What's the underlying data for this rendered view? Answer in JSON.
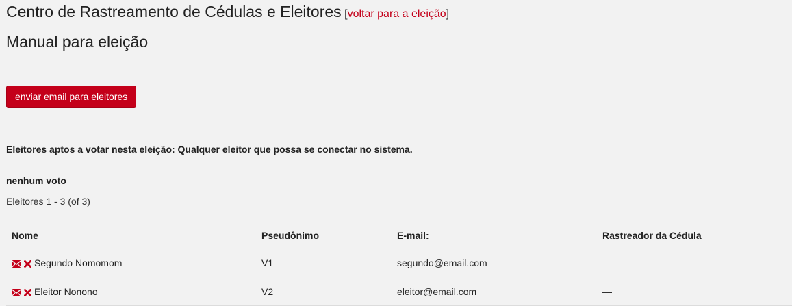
{
  "header": {
    "title": "Centro de Rastreamento de Cédulas e Eleitores",
    "back_open": "[",
    "back_link": "voltar para a eleição",
    "back_close": "]",
    "subtitle": "Manual para eleição"
  },
  "actions": {
    "email_voters_label": "enviar email para eleitores"
  },
  "info": {
    "eligibility": "Eleitores aptos a votar nesta eleição: Qualquer eleitor que possa se conectar no sistema.",
    "no_votes": "nenhum voto",
    "count": "Eleitores 1 - 3 (of 3)"
  },
  "table": {
    "headers": [
      "Nome",
      "Pseudônimo",
      "E-mail:",
      "Rastreador da Cédula"
    ],
    "rows": [
      {
        "name": "Segundo Nomomom",
        "alias": "V1",
        "email": "segundo@email.com",
        "tracker": "—"
      },
      {
        "name": "Eleitor Nonono",
        "alias": "V2",
        "email": "eleitor@email.com",
        "tracker": "—"
      }
    ]
  },
  "icons": {
    "email": "envelope-icon",
    "delete": "close-icon"
  },
  "colors": {
    "accent": "#c4001a",
    "background": "#f2f2f2"
  }
}
